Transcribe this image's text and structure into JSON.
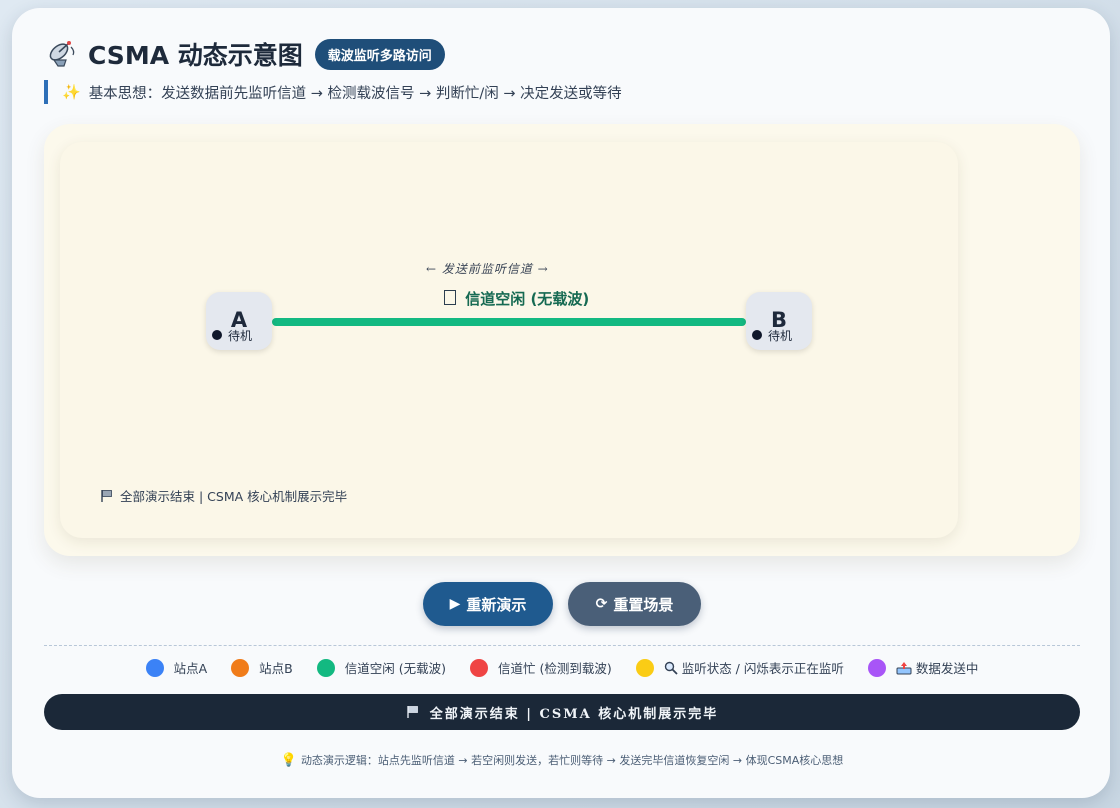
{
  "header": {
    "title": "CSMA 动态示意图",
    "badge": "载波监听多路访问",
    "subtitle": "基本思想：发送数据前先监听信道 → 检测载波信号 → 判断忙/闲 → 决定发送或等待"
  },
  "stage": {
    "hint": "← 发送前监听信道 →",
    "status": "信道空闲 (无载波)",
    "station_a": {
      "letter": "A",
      "state": "待机"
    },
    "station_b": {
      "letter": "B",
      "state": "待机"
    },
    "footer": "全部演示结束 | CSMA 核心机制展示完毕"
  },
  "controls": {
    "replay_label": "重新演示",
    "reset_label": "重置场景"
  },
  "legend": [
    {
      "label": "站点A",
      "color": "#3b82f6"
    },
    {
      "label": "站点B",
      "color": "#f07c1a"
    },
    {
      "label": "信道空闲 (无载波)",
      "color": "#13b981"
    },
    {
      "label": "信道忙 (检测到载波)",
      "color": "#ef4444"
    },
    {
      "label": "监听状态 / 闪烁表示正在监听",
      "color": "#facc15",
      "icon": "magnifier-icon"
    },
    {
      "label": "数据发送中",
      "color": "#a855f7",
      "icon": "send-icon"
    }
  ],
  "banner": "全部演示结束 | CSMA 核心机制展示完毕",
  "note": "动态演示逻辑：站点先监听信道 → 若空闲则发送，若忙则等待 → 发送完毕信道恢复空闲 → 体现CSMA核心思想",
  "colors": {
    "channel_idle": "#13b981",
    "primary": "#1f5a8f",
    "secondary": "#4a5f78",
    "banner_bg": "#1b2838"
  }
}
